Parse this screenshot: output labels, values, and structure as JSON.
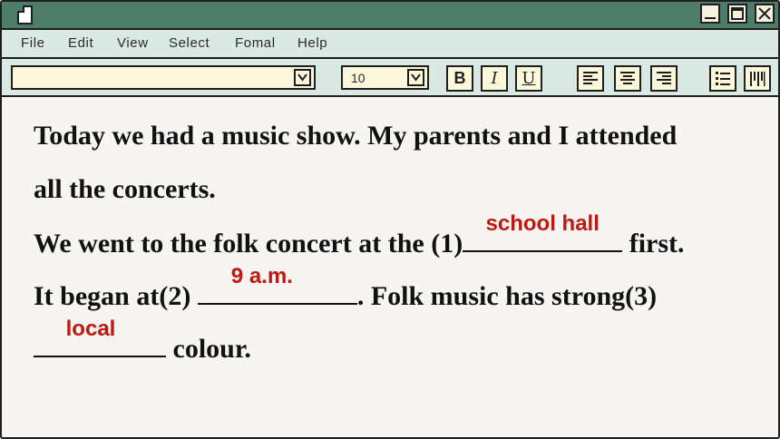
{
  "window": {
    "controls": [
      "minimize-icon",
      "maximize-icon",
      "close-icon"
    ]
  },
  "menu": {
    "items": [
      "File",
      "Edit",
      "View",
      "Select",
      "Fomal",
      "Help"
    ]
  },
  "toolbar": {
    "font_value": "",
    "size_value": "10",
    "bold_label": "B",
    "italic_label": "I",
    "underline_label": "U"
  },
  "text": {
    "line1": "Today we had a music show. My parents and I attended",
    "line2": "all the concerts.",
    "line3_a": "We went to the folk concert at the (1)",
    "line3_b": " first.",
    "line4_a": "It began at(2) ",
    "line4_b": ". Folk music has strong(3)",
    "line5_b": " colour."
  },
  "answers": {
    "a1": "school hall",
    "a2": "9 a.m.",
    "a3": "local"
  },
  "colors": {
    "titlebar": "#4f7d6c",
    "bars": "#dbe9e4",
    "answer": "#c0180f"
  }
}
